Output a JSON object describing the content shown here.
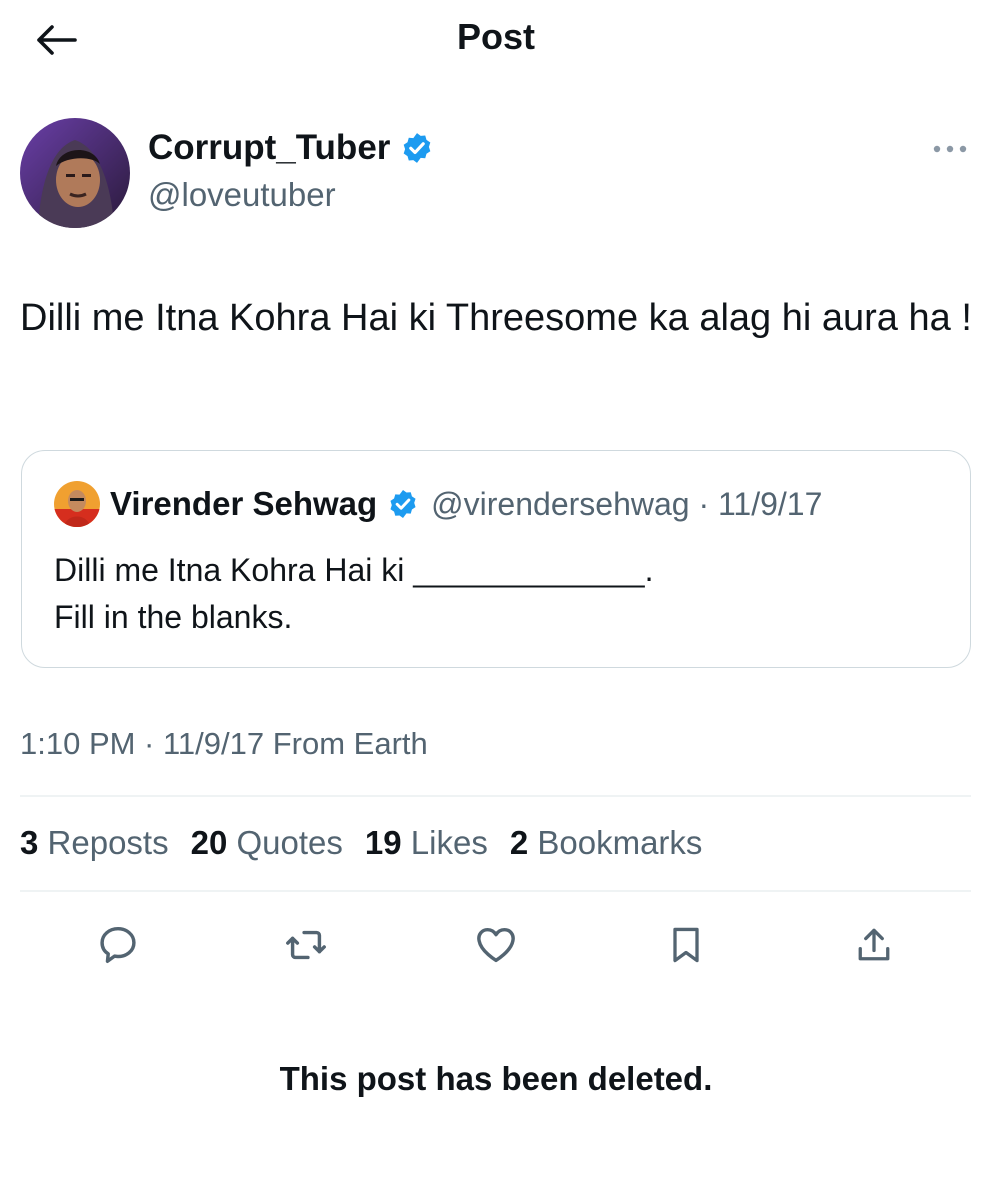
{
  "header": {
    "title": "Post"
  },
  "author": {
    "name": "Corrupt_Tuber",
    "handle": "@loveutuber",
    "verified": true
  },
  "post": {
    "text": "Dilli me Itna Kohra Hai ki Threesome ka alag hi aura ha !"
  },
  "quote": {
    "name": "Virender Sehwag",
    "meta": "@virendersehwag · 11/9/17",
    "line1": "Dilli me Itna Kohra Hai ki _____________.",
    "line2": "Fill in the blanks."
  },
  "timestamp": "1:10 PM · 11/9/17 From Earth",
  "stats": [
    {
      "count": "3",
      "label": "Reposts"
    },
    {
      "count": "20",
      "label": "Quotes"
    },
    {
      "count": "19",
      "label": "Likes"
    },
    {
      "count": "2",
      "label": "Bookmarks"
    }
  ],
  "actions": [
    "reply-icon",
    "repost-icon",
    "like-icon",
    "bookmark-icon",
    "share-icon"
  ],
  "deleted_notice": "This post has been deleted.",
  "colors": {
    "verified": "#1d9bf0",
    "text": "#0f1419",
    "secondary": "#536471",
    "border": "#cfd9de"
  }
}
